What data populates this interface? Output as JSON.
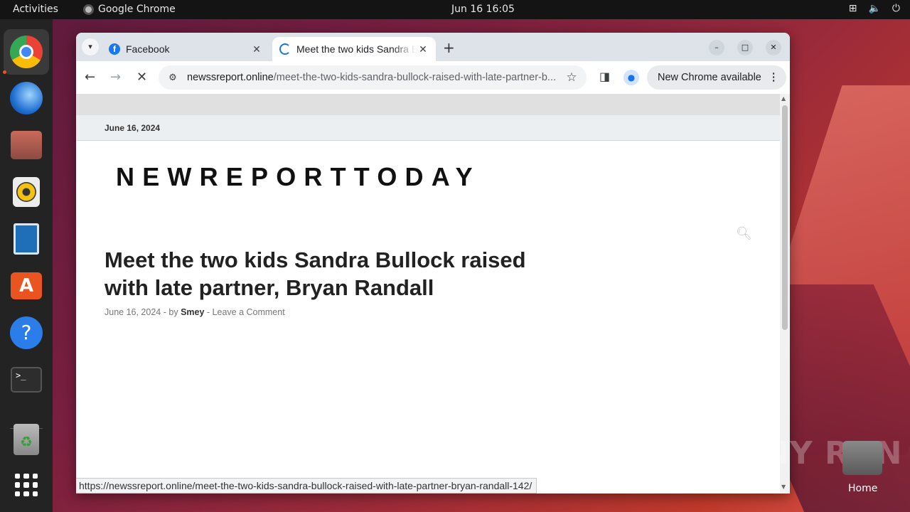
{
  "topbar": {
    "activities": "Activities",
    "app_name": "Google Chrome",
    "clock": "Jun 16  16:05",
    "tray_icons": [
      "network-icon",
      "volume-icon",
      "power-icon"
    ]
  },
  "dock": {
    "items": [
      "chrome",
      "thunderbird",
      "files",
      "rhythmbox",
      "writer",
      "app-center",
      "help",
      "terminal",
      "trash",
      "app-grid"
    ]
  },
  "browser": {
    "tabs": [
      {
        "title": "Facebook",
        "favicon": "f",
        "active": false
      },
      {
        "title": "Meet the two kids Sandra Bullock raised with late partner, Bryan Randall",
        "active": true
      }
    ],
    "new_tab": "+",
    "window_buttons": {
      "minimize": "–",
      "maximize": "□",
      "close": "✕"
    },
    "url_domain": "newssreport.online",
    "url_path": "/meet-the-two-kids-sandra-bullock-raised-with-late-partner-b...",
    "update_label": "New Chrome available",
    "status_url": "https://newssreport.online/meet-the-two-kids-sandra-bullock-raised-with-late-partner-bryan-randall-142/"
  },
  "page": {
    "top_date": "June 16, 2024",
    "site_title": "NEWREPORTTODAY",
    "headline": "Meet the two kids Sandra Bullock raised with late partner, Bryan Randall",
    "meta_date": "June 16, 2024",
    "meta_by": "by",
    "meta_author": "Smey",
    "meta_comment": "Leave a Comment"
  },
  "desktop": {
    "watermark": "ANY RUN",
    "home_label": "Home"
  },
  "colors": {
    "accent": "#1a73e8",
    "ubuntu_orange": "#e95420"
  }
}
